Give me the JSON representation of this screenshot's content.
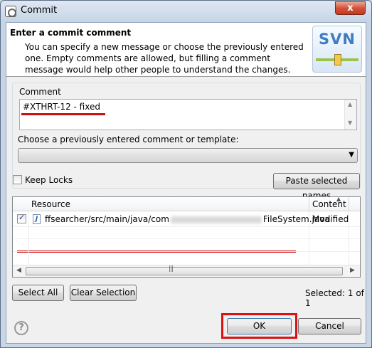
{
  "window": {
    "title": "Commit",
    "close_glyph": "x"
  },
  "banner": {
    "title": "Enter a commit comment",
    "message": "You can specify a new message or choose the previously entered one. Empty comments are allowed, but filling a comment message would help other people to understand the changes.",
    "logo_text": "SVN"
  },
  "comment": {
    "group_label": "Comment",
    "text": "#XTHRT-12 - fixed",
    "template_label": "Choose a previously entered comment or template:",
    "template_selected": ""
  },
  "keep_locks": {
    "label": "Keep Locks",
    "checked": false
  },
  "paste_button": "Paste selected names",
  "table": {
    "columns": [
      "Resource",
      "Content"
    ],
    "rows": [
      {
        "checked": true,
        "icon": "java-file-icon",
        "path_prefix": "ffsearcher/src/main/java/com",
        "path_suffix": "FileSystem.java",
        "content": "Modified"
      }
    ],
    "scroll_grip": "|||"
  },
  "buttons": {
    "select_all": "Select All",
    "clear_selection": "Clear Selection",
    "ok": "OK",
    "cancel": "Cancel"
  },
  "status": {
    "selected_text": "Selected: 1 of 1"
  },
  "help": {
    "glyph": "?"
  },
  "colors": {
    "annotation_red": "#dd1111",
    "svn_blue": "#3f7cc0"
  }
}
